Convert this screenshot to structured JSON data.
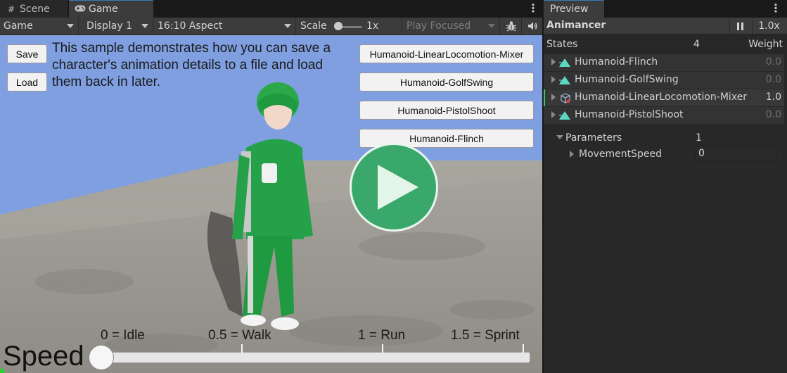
{
  "game_window": {
    "tabs": {
      "scene": "Scene",
      "game": "Game"
    },
    "toolbar": {
      "mode": "Game",
      "display": "Display 1",
      "aspect": "16:10 Aspect",
      "scale_label": "Scale",
      "scale_value": "1x",
      "play_focused": "Play Focused"
    },
    "viewport": {
      "save_label": "Save",
      "load_label": "Load",
      "description": "This sample demonstrates how you can save a character's animation details to a file and load them back in later.",
      "animation_buttons": [
        "Humanoid-LinearLocomotion-Mixer",
        "Humanoid-GolfSwing",
        "Humanoid-PistolShoot",
        "Humanoid-Flinch"
      ],
      "speed_label": "Speed",
      "speed_ticks": [
        "0 = Idle",
        "0.5 = Walk",
        "1 = Run",
        "1.5 = Sprint"
      ],
      "speed_value": 0
    },
    "colors": {
      "sky": "#7f9fe0",
      "play_button": "#3aa86b"
    }
  },
  "preview_window": {
    "tab": "Preview",
    "title": "Animancer",
    "speed": "1.0x",
    "states_label": "States",
    "states_count": "4",
    "weight_label": "Weight",
    "states": [
      {
        "name": "Humanoid-Flinch",
        "weight": "0.0",
        "icon": "animation-clip-icon",
        "active": false
      },
      {
        "name": "Humanoid-GolfSwing",
        "weight": "0.0",
        "icon": "animation-clip-icon",
        "active": false
      },
      {
        "name": "Humanoid-LinearLocomotion-Mixer",
        "weight": "1.0",
        "icon": "blend-tree-icon",
        "active": true
      },
      {
        "name": "Humanoid-PistolShoot",
        "weight": "0.0",
        "icon": "animation-clip-icon",
        "active": false
      }
    ],
    "parameters_label": "Parameters",
    "parameters_count": "1",
    "parameters": [
      {
        "name": "MovementSpeed",
        "value": "0"
      }
    ]
  }
}
